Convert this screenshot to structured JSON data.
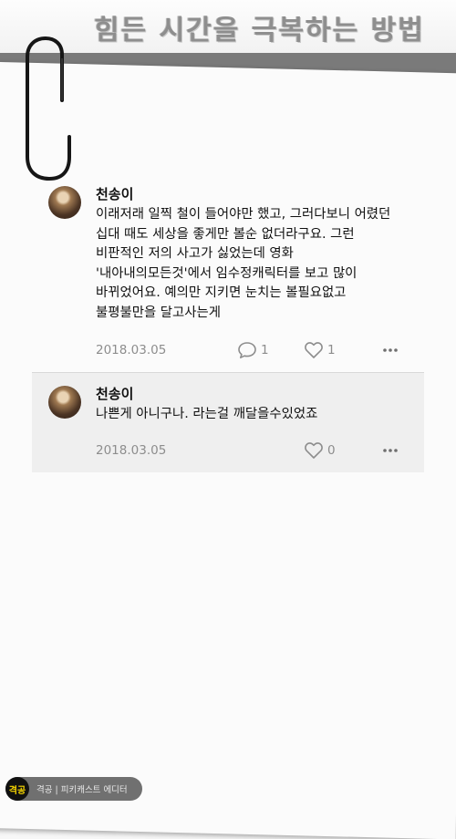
{
  "header": {
    "title": "힘든 시간을 극복하는 방법"
  },
  "comments": [
    {
      "author": "천송이",
      "body": "이래저래 일찍 철이 들어야만 했고, 그러다보니 어렸던\n십대 때도 세상을 좋게만 볼순 없더라구요. 그런\n비판적인 저의 사고가 싫었는데 영화\n'내아내의모든것'에서 임수정캐릭터를 보고 많이\n바뀌었어요. 예의만 지키면 눈치는 볼필요없고\n불평불만을 달고사는게",
      "date": "2018.03.05",
      "replies": "1",
      "likes": "1"
    },
    {
      "author": "천송이",
      "body": "나쁜게 아니구나. 라는걸 깨달을수있었죠",
      "date": "2018.03.05",
      "likes": "0"
    }
  ],
  "footer": {
    "logo_text": "격공",
    "label": "격공 | 피키캐스트 에디터"
  },
  "colors": {
    "meta": "#8d8d8d",
    "reply_bg": "#efefef",
    "band": "#7a7a7a"
  }
}
